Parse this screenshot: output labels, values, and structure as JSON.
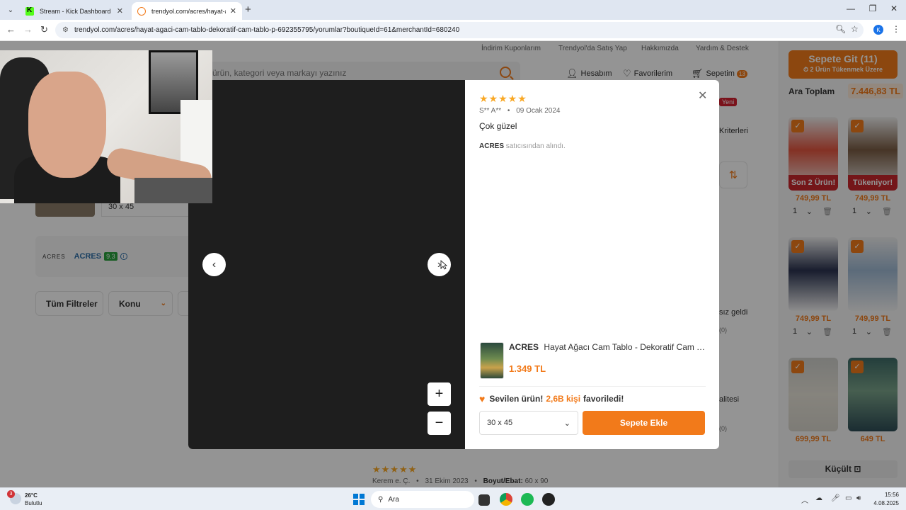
{
  "browser": {
    "tabs": [
      {
        "title": "Stream - Kick Dashboard"
      },
      {
        "title": "trendyol.com/acres/hayat-agaci"
      }
    ],
    "url": "trendyol.com/acres/hayat-agaci-cam-tablo-dekoratif-cam-tablo-p-692355795/yorumlar?boutiqueId=61&merchantId=680240",
    "profile_initial": "K"
  },
  "site": {
    "top_links": [
      "İndirim Kuponlarım",
      "Trendyol'da Satış Yap",
      "Hakkımızda",
      "Yardım & Destek"
    ],
    "search_placeholder": "ürün, kategori veya markayı yazınız",
    "account": "Hesabım",
    "favorites": "Favorilerim",
    "cart": "Sepetim",
    "cart_count": "13",
    "new_badge": "Yeni",
    "bg_texts": {
      "criteria": "Kriterleri",
      "arrived": "sız geldi",
      "quality": "alitesi",
      "count1": "(0)",
      "count2": "(0)"
    },
    "product_size": "30 x 45",
    "seller": {
      "logo": "ACRES",
      "name": "ACRES",
      "score": "9.3"
    },
    "filters": [
      "Tüm Filtreler",
      "Konu",
      "R"
    ],
    "bg_review": {
      "stars": "★★★★★",
      "author": "Kerem e. Ç.",
      "date": "31 Ekim 2023",
      "size_label": "Boyut/Ebat:",
      "size_value": "60 x 90"
    }
  },
  "cart_panel": {
    "go_label": "Sepete Git (11)",
    "sold_out_note": "2 Ürün Tükenmek Üzere",
    "subtotal_label": "Ara Toplam",
    "subtotal_value": "7.446,83 TL",
    "items": [
      {
        "price": "749,99 TL",
        "qty": "1",
        "badge": "Son 2 Ürün!",
        "color": "#e2553f"
      },
      {
        "price": "749,99 TL",
        "qty": "1",
        "badge": "Tükeniyor!",
        "color": "#7a5c43"
      },
      {
        "price": "749,99 TL",
        "qty": "1",
        "badge": "",
        "color": "#2b3350"
      },
      {
        "price": "749,99 TL",
        "qty": "1",
        "badge": "",
        "color": "#9fb9d3"
      },
      {
        "price": "699,99 TL",
        "qty": "",
        "badge": "",
        "color": "#e7e3d8"
      },
      {
        "price": "649 TL",
        "qty": "",
        "badge": "",
        "color": "#5a8a7a"
      }
    ],
    "collapse_label": "Küçült"
  },
  "modal": {
    "stars": "★★★★★",
    "reviewer": "S** A**",
    "date": "09 Ocak 2024",
    "comment": "Çok güzel",
    "seller_name": "ACRES",
    "seller_suffix": "satıcısından alındı.",
    "product": {
      "brand": "ACRES",
      "title": "Hayat Ağacı Cam Tablo - Dekoratif Cam Tabl...",
      "price": "1.349 TL"
    },
    "favorites": {
      "prefix": "Sevilen ürün!",
      "count": "2,6B kişi",
      "suffix": "favoriledi!"
    },
    "size_value": "30 x 45",
    "add_to_cart": "Sepete Ekle"
  },
  "taskbar": {
    "weather_badge": "3",
    "temp": "26°C",
    "condition": "Bulutlu",
    "search_label": "Ara",
    "time": "15:56",
    "date": "4.08.2025"
  },
  "colors": {
    "brand_orange": "#f27a1a",
    "star": "#f9a825",
    "badge_red": "#c8262c"
  }
}
